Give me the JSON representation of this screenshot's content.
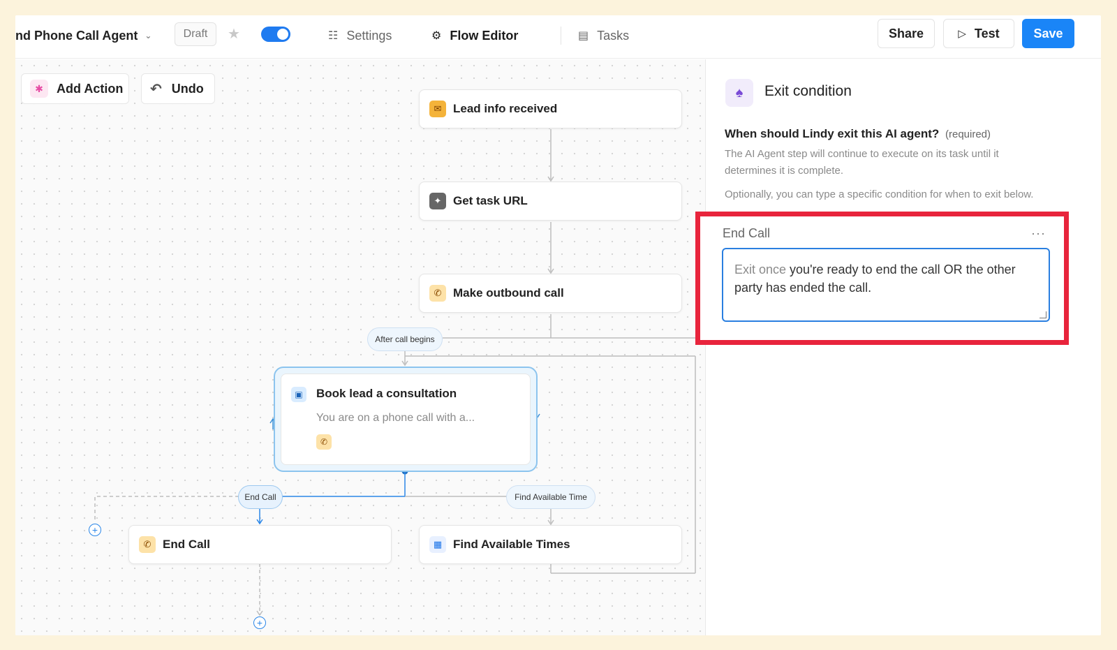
{
  "topbar": {
    "agent_title": "nd Phone Call Agent",
    "draft_label": "Draft",
    "nav": {
      "settings": "Settings",
      "flow_editor": "Flow Editor",
      "tasks": "Tasks"
    },
    "share_label": "Share",
    "test_label": "Test",
    "save_label": "Save",
    "toggle_enabled": true,
    "accent_color": "#1a85f7"
  },
  "canvas": {
    "add_action_label": "Add Action",
    "undo_label": "Undo",
    "nodes": {
      "lead": "Lead info received",
      "task_url": "Get task URL",
      "outbound": "Make outbound call",
      "book_title": "Book lead a consultation",
      "book_desc": "You are on a phone call with a...",
      "end_call": "End Call",
      "find_times": "Find Available Times"
    },
    "pills": {
      "after_call": "After call begins",
      "end_call": "End Call",
      "find_time": "Find Available Time"
    }
  },
  "panel": {
    "title": "Exit condition",
    "question": "When should Lindy exit this AI agent?",
    "required": "(required)",
    "help1": "The AI Agent step will continue to execute on its task until it determines it is complete.",
    "help2": "Optionally, you can type a specific condition for when to exit below.",
    "condition": {
      "label": "End Call",
      "more": "···",
      "placeholder_prefix": "Exit once",
      "value": " you're ready to end the call OR the other party has ended the call."
    },
    "highlight_color": "#e8243c"
  }
}
